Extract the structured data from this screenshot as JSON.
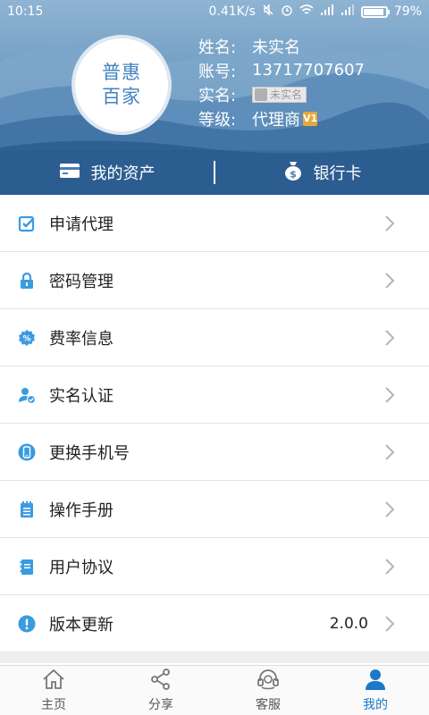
{
  "status": {
    "time": "10:15",
    "speed": "0.41K/s",
    "battery": "79%"
  },
  "profile": {
    "avatar_line1": "普惠",
    "avatar_line2": "百家",
    "name_label": "姓名:",
    "name_value": "未实名",
    "account_label": "账号:",
    "account_value": "13717707607",
    "realname_label": "实名:",
    "realname_badge": "未实名",
    "level_label": "等级:",
    "level_value": "代理商",
    "level_badge": "V1"
  },
  "assets": {
    "my_assets": "我的资产",
    "bank_card": "银行卡"
  },
  "menu": [
    {
      "label": "申请代理",
      "icon": "check-square-icon"
    },
    {
      "label": "密码管理",
      "icon": "lock-icon"
    },
    {
      "label": "费率信息",
      "icon": "percent-badge-icon"
    },
    {
      "label": "实名认证",
      "icon": "user-verified-icon"
    },
    {
      "label": "更换手机号",
      "icon": "phone-icon"
    },
    {
      "label": "操作手册",
      "icon": "notepad-icon"
    },
    {
      "label": "用户协议",
      "icon": "document-icon"
    },
    {
      "label": "版本更新",
      "icon": "exclamation-icon",
      "value": "2.0.0"
    }
  ],
  "tabs": [
    {
      "label": "主页",
      "icon": "home-icon",
      "active": false
    },
    {
      "label": "分享",
      "icon": "share-icon",
      "active": false
    },
    {
      "label": "客服",
      "icon": "headset-icon",
      "active": false
    },
    {
      "label": "我的",
      "icon": "person-icon",
      "active": true
    }
  ],
  "colors": {
    "accent": "#1b79c6",
    "icon_blue": "#3b9be0"
  }
}
